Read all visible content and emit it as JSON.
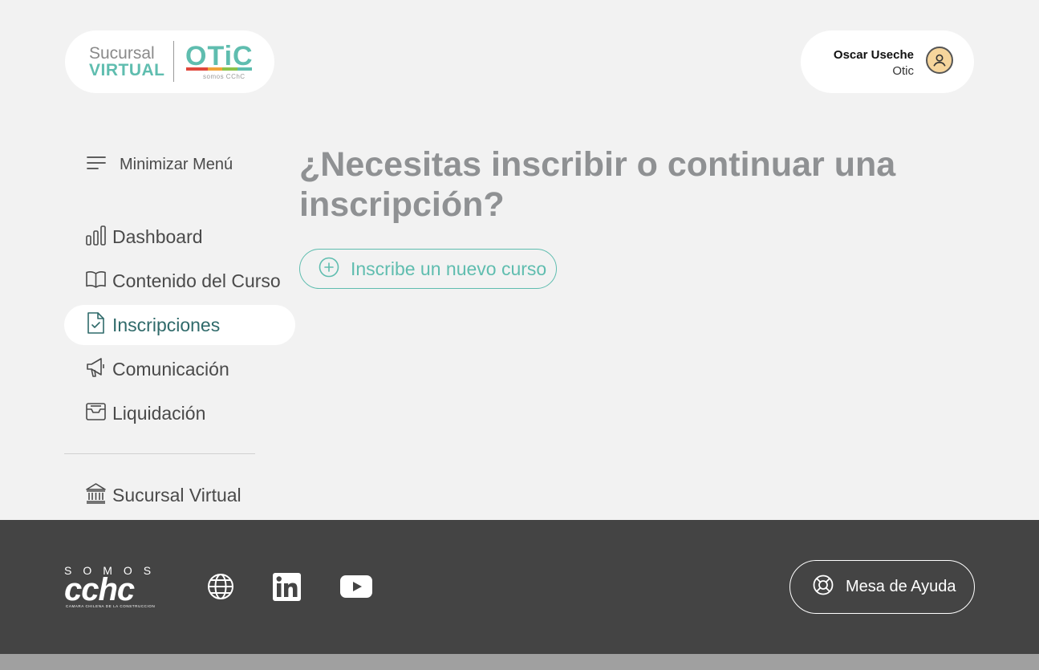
{
  "header": {
    "logo": {
      "line1": "Sucursal",
      "line2": "VIRTUAL",
      "brand": "OTiC",
      "tagline": "somos CChC"
    },
    "user": {
      "name": "Oscar Useche",
      "role": "Otic",
      "avatar_icon": "user-circle-icon"
    }
  },
  "sidebar": {
    "toggle_label": "Minimizar Menú",
    "items": [
      {
        "label": "Dashboard",
        "icon": "bar-chart-icon",
        "active": false
      },
      {
        "label": "Contenido del Curso",
        "icon": "book-icon",
        "active": false
      },
      {
        "label": "Inscripciones",
        "icon": "file-check-icon",
        "active": true
      },
      {
        "label": "Comunicación",
        "icon": "megaphone-icon",
        "active": false
      },
      {
        "label": "Liquidación",
        "icon": "archive-icon",
        "active": false
      }
    ],
    "secondary": [
      {
        "label": "Sucursal Virtual",
        "icon": "bank-icon"
      }
    ]
  },
  "main": {
    "title": "¿Necesitas inscribir o continuar una inscripción?",
    "new_course_button": "Inscribe un nuevo curso"
  },
  "footer": {
    "logo": {
      "top": "SOMOS",
      "big": "cchc",
      "sub": "CAMARA CHILENA DE LA CONSTRUCCION"
    },
    "social_icons": [
      "globe-icon",
      "linkedin-icon",
      "youtube-icon"
    ],
    "help_button": "Mesa de Ayuda"
  },
  "colors": {
    "accent": "#5fbdaf",
    "background": "#f2f2f2",
    "footer": "#444444",
    "title": "#8f9193",
    "active_text": "#2f6a6a"
  }
}
